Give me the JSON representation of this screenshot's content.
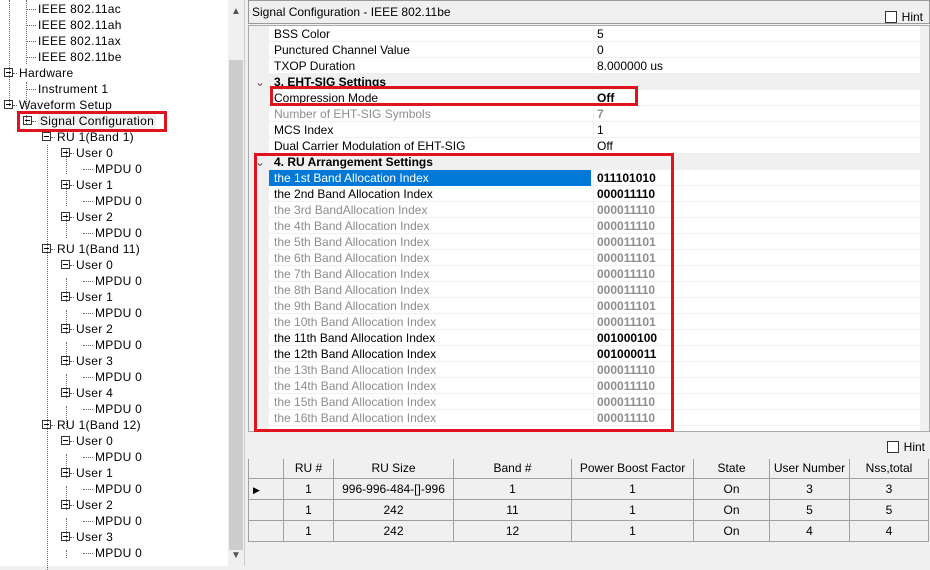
{
  "tree": {
    "items": [
      {
        "label": "IEEE 802.11ac"
      },
      {
        "label": "IEEE 802.11ah"
      },
      {
        "label": "IEEE 802.11ax"
      },
      {
        "label": "IEEE 802.11be"
      },
      {
        "label": "Hardware"
      },
      {
        "label": "Instrument 1"
      },
      {
        "label": "Waveform Setup"
      },
      {
        "label": "Signal Configuration"
      },
      {
        "label": "RU 1(Band 1)"
      },
      {
        "label": "User 0"
      },
      {
        "label": "MPDU 0"
      },
      {
        "label": "User 1"
      },
      {
        "label": "MPDU 0"
      },
      {
        "label": "User 2"
      },
      {
        "label": "MPDU 0"
      },
      {
        "label": "RU 1(Band 11)"
      },
      {
        "label": "User 0"
      },
      {
        "label": "MPDU 0"
      },
      {
        "label": "User 1"
      },
      {
        "label": "MPDU 0"
      },
      {
        "label": "User 2"
      },
      {
        "label": "MPDU 0"
      },
      {
        "label": "User 3"
      },
      {
        "label": "MPDU 0"
      },
      {
        "label": "User 4"
      },
      {
        "label": "MPDU 0"
      },
      {
        "label": "RU 1(Band 12)"
      },
      {
        "label": "User 0"
      },
      {
        "label": "MPDU 0"
      },
      {
        "label": "User 1"
      },
      {
        "label": "MPDU 0"
      },
      {
        "label": "User 2"
      },
      {
        "label": "MPDU 0"
      },
      {
        "label": "User 3"
      },
      {
        "label": "MPDU 0"
      }
    ]
  },
  "panel": {
    "title": "Signal Configuration - IEEE 802.11be",
    "hint": "Hint"
  },
  "props": {
    "top": [
      {
        "name": "BSS Color",
        "value": "5"
      },
      {
        "name": "Punctured Channel Value",
        "value": "0"
      },
      {
        "name": "TXOP Duration",
        "value": "8.000000 us"
      }
    ],
    "sec3": "3. EHT-SIG Settings",
    "eht": [
      {
        "name": "Compression Mode",
        "value": "Off"
      },
      {
        "name": "Number of EHT-SIG Symbols",
        "value": "7"
      },
      {
        "name": "MCS Index",
        "value": "1"
      },
      {
        "name": "Dual Carrier Modulation of EHT-SIG",
        "value": "Off"
      }
    ],
    "sec4": "4. RU Arrangement Settings",
    "bands": [
      {
        "name": "the 1st Band Allocation Index",
        "value": "011101010"
      },
      {
        "name": "the 2nd Band Allocation Index",
        "value": "000011110"
      },
      {
        "name": "the 3rd BandAllocation Index",
        "value": "000011110"
      },
      {
        "name": "the 4th Band Allocation Index",
        "value": "000011110"
      },
      {
        "name": "the 5th Band Allocation Index",
        "value": "000011101"
      },
      {
        "name": "the 6th Band Allocation Index",
        "value": "000011101"
      },
      {
        "name": "the 7th Band Allocation Index",
        "value": "000011110"
      },
      {
        "name": "the 8th Band Allocation Index",
        "value": "000011110"
      },
      {
        "name": "the 9th Band Allocation Index",
        "value": "000011101"
      },
      {
        "name": "the 10th Band Allocation Index",
        "value": "000011101"
      },
      {
        "name": "the 11th Band Allocation Index",
        "value": "001000100"
      },
      {
        "name": "the 12th Band Allocation Index",
        "value": "001000011"
      },
      {
        "name": "the 13th Band Allocation Index",
        "value": "000011110"
      },
      {
        "name": "the 14th Band Allocation Index",
        "value": "000011110"
      },
      {
        "name": "the 15th Band Allocation Index",
        "value": "000011110"
      },
      {
        "name": "the 16th Band Allocation Index",
        "value": "000011110"
      }
    ]
  },
  "bottom": {
    "hint": "Hint",
    "headers": [
      "RU #",
      "RU Size",
      "Band #",
      "Power Boost Factor",
      "State",
      "User Number",
      "Nss,total"
    ],
    "rows": [
      [
        "1",
        "996-996-484-[]-996",
        "1",
        "1",
        "On",
        "3",
        "3"
      ],
      [
        "1",
        "242",
        "11",
        "1",
        "On",
        "5",
        "5"
      ],
      [
        "1",
        "242",
        "12",
        "1",
        "On",
        "4",
        "4"
      ]
    ]
  },
  "colors": {
    "highlight": "#e0141e",
    "selection": "#0078d7"
  }
}
